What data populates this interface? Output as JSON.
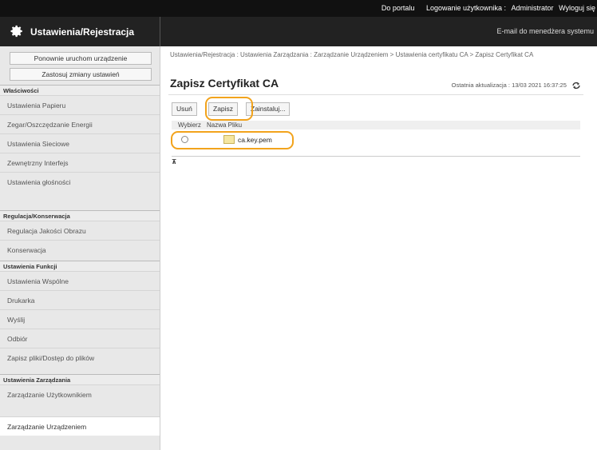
{
  "header": {
    "links": [
      "Do portalu",
      "Logowanie użytkownika :",
      "Administrator",
      "Wyloguj się"
    ],
    "title": "Ustawienia/Rejestracja",
    "mail_link": "E-mail do menedżera systemu",
    "gear_icon": "gear-icon"
  },
  "sidebar": {
    "buttons": [
      "Ponownie uruchom urządzenie",
      "Zastosuj zmiany ustawień"
    ],
    "sections": [
      {
        "title": "Właściwości",
        "items": [
          "Ustawienia Papieru",
          "Zegar/Oszczędzanie Energii",
          "Ustawienia Sieciowe",
          "Zewnętrzny Interfejs",
          "Ustawienia głośności"
        ]
      },
      {
        "title": "Regulacja/Konserwacja",
        "items": [
          "Regulacja Jakości Obrazu",
          "Konserwacja"
        ]
      },
      {
        "title": "Ustawienia Funkcji",
        "items": [
          "Ustawienia Wspólne",
          "Drukarka",
          "Wyślij",
          "Odbiór",
          "Zapisz pliki/Dostęp do plików"
        ]
      },
      {
        "title": "Ustawienia Zarządzania",
        "items": [
          "Zarządzanie Użytkownikiem",
          "Zarządzanie Urządzeniem"
        ]
      }
    ],
    "active_item": "Zarządzanie Urządzeniem"
  },
  "main": {
    "breadcrumb": "Ustawienia/Rejestracja : Ustawienia Zarządzania : Zarządzanie Urządzeniem > Ustawienia certyfikatu CA > Zapisz Certyfikat CA",
    "page_title": "Zapisz Certyfikat CA",
    "last_update": "Ostatnia aktualizacja : 13/03 2021 16:37:25",
    "toolbar": {
      "delete": "Usuń",
      "save": "Zapisz",
      "install": "Zainstaluj..."
    },
    "table": {
      "headers": [
        "Wybierz",
        "Nazwa Pliku"
      ],
      "rows": [
        {
          "file": "ca.key.pem",
          "selected": false
        }
      ]
    },
    "top_link": "⊼"
  },
  "colors": {
    "highlight": "#f2a31c",
    "header_bg": "#111111",
    "title_bg": "#222222"
  }
}
